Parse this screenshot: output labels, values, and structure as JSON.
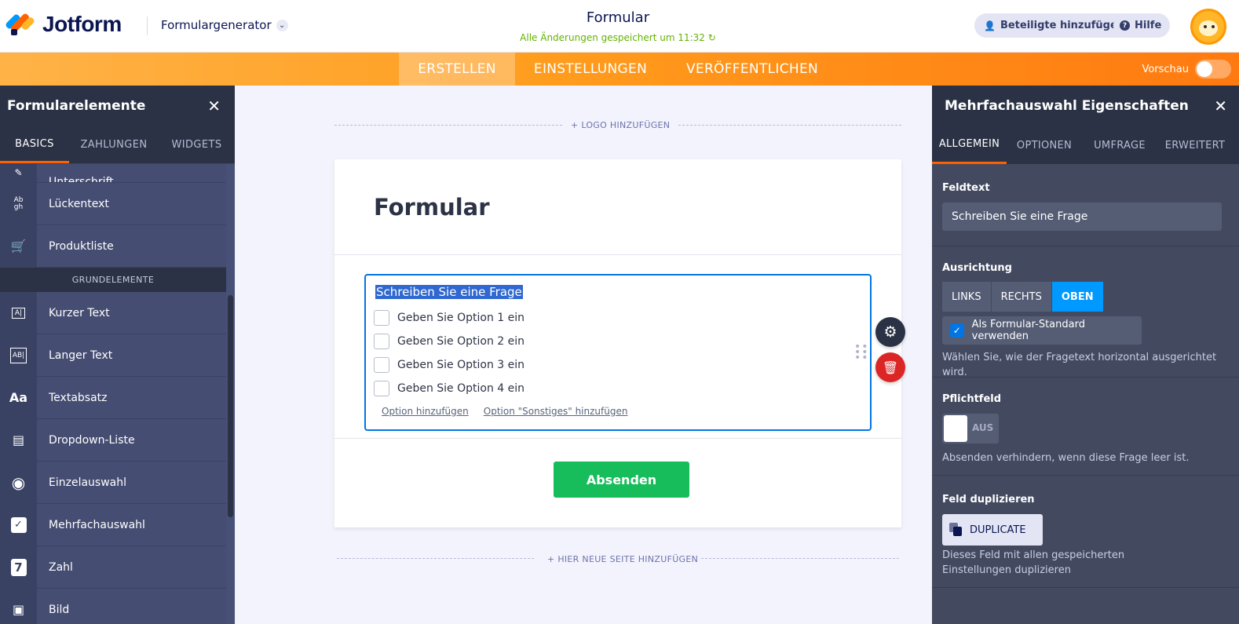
{
  "header": {
    "logo_text": "Jotform",
    "generator_label": "Formulargenerator",
    "form_title": "Formular",
    "save_status": "Alle Änderungen gespeichert um 11:32 ↻",
    "add_participants_label": "Beteiligte hinzufügen",
    "help_label": "Hilfe"
  },
  "navbar": {
    "tabs": [
      "ERSTELLEN",
      "EINSTELLUNGEN",
      "VERÖFFENTLICHEN"
    ],
    "active_tab": "ERSTELLEN",
    "preview_label": "Vorschau",
    "preview_enabled": false
  },
  "left_panel": {
    "title": "Formularelemente",
    "tabs": [
      "BASICS",
      "ZAHLUNGEN",
      "WIDGETS"
    ],
    "active_tab": "BASICS",
    "partial_item": "Unterschrift",
    "items_top": [
      {
        "label": "Lückentext",
        "icon": "fill-blank-icon"
      },
      {
        "label": "Produktliste",
        "icon": "cart-icon"
      }
    ],
    "group_label": "GRUNDELEMENTE",
    "items": [
      {
        "label": "Kurzer Text",
        "icon": "short-text-icon"
      },
      {
        "label": "Langer Text",
        "icon": "long-text-icon"
      },
      {
        "label": "Textabsatz",
        "icon": "paragraph-icon"
      },
      {
        "label": "Dropdown-Liste",
        "icon": "dropdown-icon"
      },
      {
        "label": "Einzelauswahl",
        "icon": "radio-icon"
      },
      {
        "label": "Mehrfachauswahl",
        "icon": "checkbox-icon"
      },
      {
        "label": "Zahl",
        "icon": "number-icon"
      },
      {
        "label": "Bild",
        "icon": "image-icon"
      }
    ]
  },
  "canvas": {
    "add_logo_label": "+ LOGO HINZUFÜGEN",
    "form_heading": "Formular",
    "question_text": "Schreiben Sie eine Frage",
    "options": [
      "Geben Sie Option 1 ein",
      "Geben Sie Option 2 ein",
      "Geben Sie Option 3 ein",
      "Geben Sie Option 4 ein"
    ],
    "add_option_link": "Option hinzufügen",
    "add_other_link": "Option \"Sonstiges\" hinzufügen",
    "submit_label": "Absenden",
    "add_page_label": "+ HIER NEUE SEITE HINZUFÜGEN"
  },
  "right_panel": {
    "title": "Mehrfachauswahl Eigenschaften",
    "tabs": [
      "ALLGEMEIN",
      "OPTIONEN",
      "UMFRAGE",
      "ERWEITERT"
    ],
    "active_tab": "ALLGEMEIN",
    "field_text_label": "Feldtext",
    "field_text_value": "Schreiben Sie eine Frage",
    "alignment_label": "Ausrichtung",
    "alignment_options": [
      "LINKS",
      "RECHTS",
      "OBEN"
    ],
    "alignment_selected": "OBEN",
    "default_checkbox_label": "Als Formular-Standard verwenden",
    "default_checked": true,
    "alignment_hint": "Wählen Sie, wie der Fragetext horizontal ausgerichtet wird.",
    "required_label": "Pflichtfeld",
    "required_state": "AUS",
    "required_hint": "Absenden verhindern, wenn diese Frage leer ist.",
    "duplicate_label": "Feld duplizieren",
    "duplicate_button": "DUPLICATE",
    "duplicate_hint": "Dieses Feld mit allen gespeicherten Einstellungen duplizieren"
  },
  "colors": {
    "brand_orange": "#ff7a10",
    "accent_blue": "#0099ff",
    "submit_green": "#18bd5b",
    "delete_red": "#dc2626",
    "panel_dark": "#2b3245"
  }
}
